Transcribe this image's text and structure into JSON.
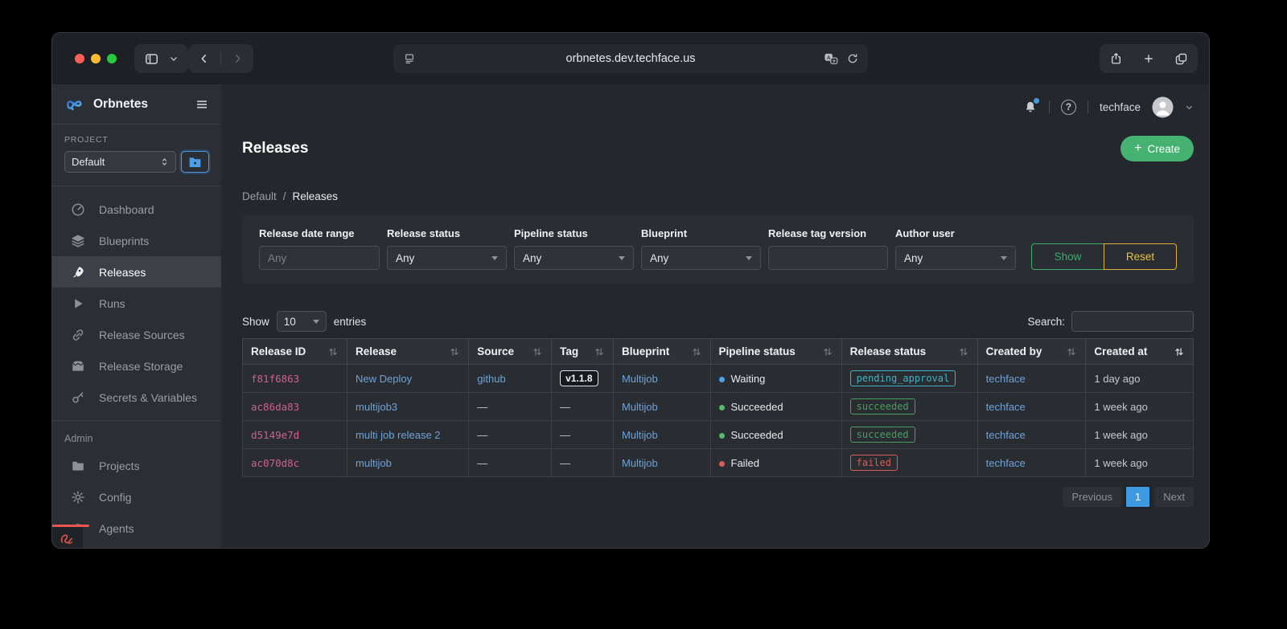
{
  "browser": {
    "url": "orbnetes.dev.techface.us"
  },
  "app_header": {
    "username": "techface"
  },
  "sidebar": {
    "logo_text": "Orbnetes",
    "project_label": "PROJECT",
    "project_value": "Default",
    "nav_items": [
      {
        "label": "Dashboard",
        "icon": "gauge",
        "active": false
      },
      {
        "label": "Blueprints",
        "icon": "layers",
        "active": false
      },
      {
        "label": "Releases",
        "icon": "rocket",
        "active": true
      },
      {
        "label": "Runs",
        "icon": "play",
        "active": false
      },
      {
        "label": "Release Sources",
        "icon": "link",
        "active": false
      },
      {
        "label": "Release Storage",
        "icon": "archive",
        "active": false
      },
      {
        "label": "Secrets & Variables",
        "icon": "key",
        "active": false
      }
    ],
    "admin_label": "Admin",
    "admin_items": [
      {
        "label": "Projects",
        "icon": "folder",
        "active": false
      },
      {
        "label": "Config",
        "icon": "gear",
        "active": false
      },
      {
        "label": "Agents",
        "icon": "robot",
        "active": false
      }
    ]
  },
  "page": {
    "title": "Releases",
    "create_button": "Create",
    "breadcrumb": [
      "Default",
      "Releases"
    ]
  },
  "filters": {
    "fields": [
      {
        "label": "Release date range",
        "type": "input",
        "placeholder": "Any",
        "value": ""
      },
      {
        "label": "Release status",
        "type": "select",
        "value": "Any"
      },
      {
        "label": "Pipeline status",
        "type": "select",
        "value": "Any"
      },
      {
        "label": "Blueprint",
        "type": "select",
        "value": "Any"
      },
      {
        "label": "Release tag version",
        "type": "input",
        "placeholder": "",
        "value": ""
      },
      {
        "label": "Author user",
        "type": "select",
        "value": "Any"
      }
    ],
    "show_button": "Show",
    "reset_button": "Reset"
  },
  "table_controls": {
    "show_label": "Show",
    "page_size": "10",
    "entries_label": "entries",
    "search_label": "Search:",
    "search_value": ""
  },
  "table": {
    "columns": [
      "Release ID",
      "Release",
      "Source",
      "Tag",
      "Blueprint",
      "Pipeline status",
      "Release status",
      "Created by",
      "Created at"
    ],
    "column_widths_pct": [
      11.0,
      12.8,
      8.7,
      6.5,
      10.2,
      13.8,
      14.3,
      11.4,
      11.3
    ],
    "sorted_column": "Created at",
    "rows": [
      {
        "release_id": "f81f6863",
        "release": "New Deploy",
        "source": "github",
        "tag": "v1.1.8",
        "blueprint": "Multijob",
        "pipeline_status": "Waiting",
        "pipeline_color": "#4da3e8",
        "release_status": "pending_approval",
        "release_status_color": "#3fb6c6",
        "created_by": "techface",
        "created_at": "1 day ago"
      },
      {
        "release_id": "ac86da83",
        "release": "multijob3",
        "source": "—",
        "tag": "—",
        "blueprint": "Multijob",
        "pipeline_status": "Succeeded",
        "pipeline_color": "#57b86a",
        "release_status": "succeeded",
        "release_status_color": "#4a9e5f",
        "created_by": "techface",
        "created_at": "1 week ago"
      },
      {
        "release_id": "d5149e7d",
        "release": "multi job release 2",
        "source": "—",
        "tag": "—",
        "blueprint": "Multijob",
        "pipeline_status": "Succeeded",
        "pipeline_color": "#57b86a",
        "release_status": "succeeded",
        "release_status_color": "#4a9e5f",
        "created_by": "techface",
        "created_at": "1 week ago"
      },
      {
        "release_id": "ac070d8c",
        "release": "multijob",
        "source": "—",
        "tag": "—",
        "blueprint": "Multijob",
        "pipeline_status": "Failed",
        "pipeline_color": "#dd5b56",
        "release_status": "failed",
        "release_status_color": "#dd5b56",
        "created_by": "techface",
        "created_at": "1 week ago"
      }
    ]
  },
  "pagination": {
    "previous": "Previous",
    "page": "1",
    "next": "Next"
  },
  "colors": {
    "accent_green": "#45b272",
    "show_green": "#3eac6f",
    "reset_yellow": "#d9b43a",
    "link_blue": "#6ea3d8",
    "release_id_pink": "#d0618d",
    "pagination_blue": "#3e9ae0",
    "notification_blue": "#3f9bdc",
    "focus_blue": "#4c9be8",
    "dev_badge_red": "#e8564e"
  }
}
